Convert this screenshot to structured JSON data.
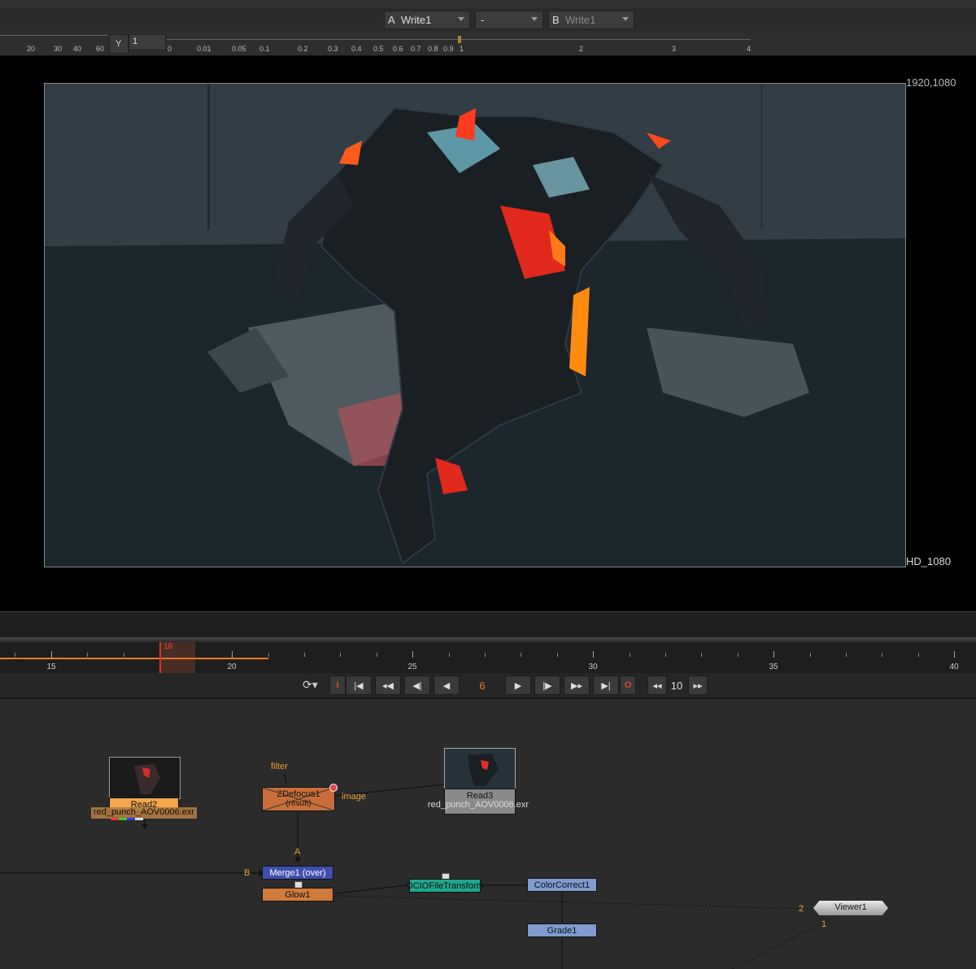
{
  "viewer_header": {
    "input_a_tag": "A",
    "input_a_value": "Write1",
    "wipe_mode": "-",
    "input_b_tag": "B",
    "input_b_value": "Write1"
  },
  "ruler": {
    "left_ticks": [
      "20",
      "30",
      "40",
      "60"
    ],
    "y_label": "Y",
    "y_value": "1",
    "right_ticks": [
      "0",
      "0.01",
      "0.05",
      "0.1",
      "0.2",
      "0.3",
      "0.4",
      "0.5",
      "0.6",
      "0.7",
      "0.8",
      "0.9",
      "1",
      "2",
      "3",
      "4"
    ]
  },
  "viewer": {
    "resolution_label": "1920,1080",
    "format_label": "HD_1080"
  },
  "timeline": {
    "current_frame_marker": "18",
    "labels": [
      "15",
      "20",
      "25",
      "30",
      "35",
      "40"
    ]
  },
  "transport": {
    "in_point": "I",
    "out_point": "O",
    "current_frame": "6",
    "increment": "10"
  },
  "nodegraph": {
    "read2": {
      "name": "Read2",
      "file": "red_punch_AOV0006.exr"
    },
    "read3": {
      "name": "Read3",
      "file": "red_punch_AOV0006.exr"
    },
    "zdefocus": {
      "name": "ZDefocus1",
      "sub": "(result)"
    },
    "filter_label": "filter",
    "image_label": "image",
    "merge": {
      "name": "Merge1 (over)"
    },
    "glow": {
      "name": "Glow1"
    },
    "ocio": {
      "name": "OCIOFileTransform"
    },
    "colorcorrect": {
      "name": "ColorCorrect1"
    },
    "grade": {
      "name": "Grade1"
    },
    "viewer": {
      "name": "Viewer1"
    },
    "input_a": "A",
    "input_b": "B",
    "viewer_in_1": "1",
    "viewer_in_2": "2"
  },
  "colors": {
    "accent_orange": "#f07a20",
    "playhead_red": "#d9342b",
    "read_node": "#f3a64d",
    "zdefocus_node": "#c96e3a",
    "merge_node": "#3f4fb0",
    "glow_node": "#d07a3c",
    "ocio_node": "#1fa78c",
    "colorcorrect_node": "#7f9bcf"
  }
}
